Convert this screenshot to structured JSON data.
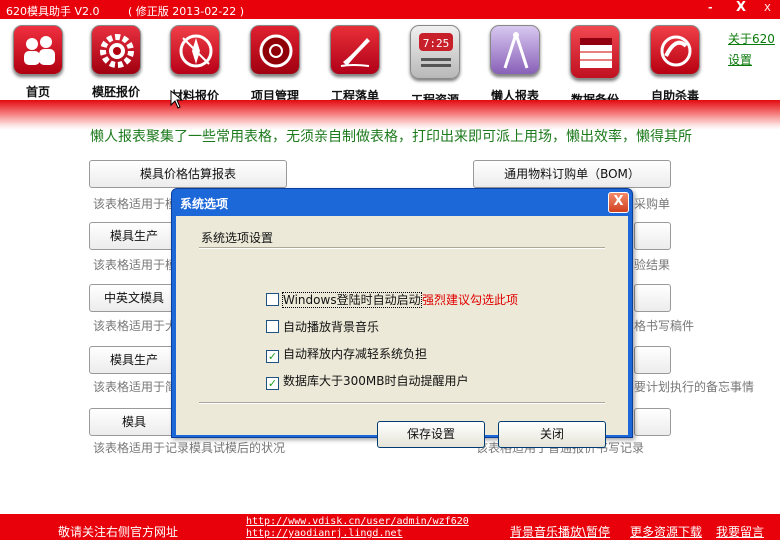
{
  "window": {
    "app_title": "620模具助手 V2.0",
    "version_note": "( 修正版 2013-02-22 )",
    "minimize_glyph": "-",
    "close_glyph": "X",
    "extra_glyph": "X"
  },
  "toolbar": {
    "items": [
      {
        "label": "首页",
        "icon": "home-people-icon",
        "color": "#d40010"
      },
      {
        "label": "模胚报价",
        "icon": "gear-icon",
        "color": "#c8101a"
      },
      {
        "label": "材料报价",
        "icon": "compass-icon",
        "color": "#e0181e"
      },
      {
        "label": "项目管理",
        "icon": "disc-icon",
        "color": "#c80010"
      },
      {
        "label": "工程落单",
        "icon": "pen-icon",
        "color": "#d01018"
      },
      {
        "label": "工程资源",
        "icon": "clock-icon",
        "color": "#d8d8d8"
      },
      {
        "label": "懒人报表",
        "icon": "ruler-icon",
        "color": "#b8a0d8"
      },
      {
        "label": "数据备份",
        "icon": "calendar-icon",
        "color": "#e82030"
      },
      {
        "label": "自助杀毒",
        "icon": "antivirus-icon",
        "color": "#e01020"
      }
    ],
    "side_links": [
      "关于620",
      "设置"
    ]
  },
  "main": {
    "intro": "懒人报表聚集了一些常用表格，无须亲自制做表格，打印出来即可派上用场，懒出效率，懒得其所",
    "left_buttons": [
      "模具价格估算报表",
      "模具生产",
      "中英文模具",
      "模具生产",
      "模具"
    ],
    "left_descs": [
      "该表格适用于模",
      "该表格适用于模",
      "该表格适用于大",
      "该表格适用于简",
      "该表格适用于记录模具试模后的状况"
    ],
    "right_buttons": [
      "通用物料订购单（BOM）",
      "",
      "",
      "",
      ""
    ],
    "right_descs": [
      "采购单",
      "验结果",
      "格书写稿件",
      "要计划执行的备忘事情",
      "该表格适用于普通报价书写记录"
    ]
  },
  "dialog": {
    "title": "系统选项",
    "close_glyph": "X",
    "group_title": "系统选项设置",
    "options": [
      {
        "label": "Windows登陆时自动启动",
        "checked": false
      },
      {
        "label": "自动播放背景音乐",
        "checked": false
      },
      {
        "label": "自动释放内存减轻系统负担",
        "checked": true
      },
      {
        "label": "数据库大于300MB时自动提醒用户",
        "checked": true
      }
    ],
    "warning": "强烈建议勾选此项",
    "save_label": "保存设置",
    "close_label": "关闭"
  },
  "footer": {
    "notice": "敬请关注右侧官方网址",
    "url1": "http://www.vdisk.cn/user/admin/wzf620",
    "url2": "http://yaodianrj.lingd.net",
    "music_toggle": "背景音乐播放\\暂停",
    "more_resources": "更多资源下载",
    "leave_message": "我要留言"
  },
  "colors": {
    "brand_red": "#e8000a",
    "intro_green": "#1d7a1d",
    "dialog_blue": "#1c68d8",
    "warning_red": "#e00000"
  }
}
